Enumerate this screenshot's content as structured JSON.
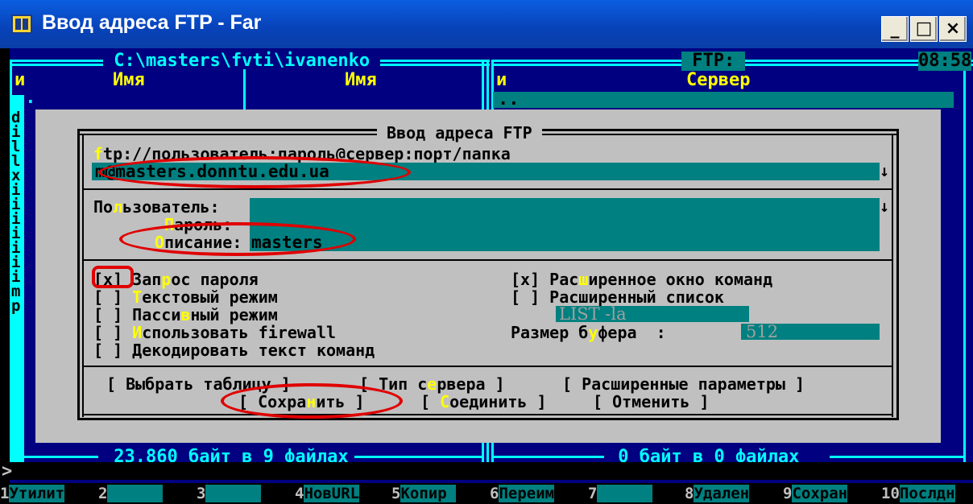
{
  "window": {
    "title": "Ввод адреса FTP - Far",
    "min_label": "_",
    "max_label": "□",
    "close_label": "×"
  },
  "left_panel": {
    "path": " C:\\masters\\fvti\\ivanenko ",
    "col_n": "и",
    "col_name1": "Имя",
    "col_name2": "Имя",
    "updir": "..",
    "file_letters": [
      "d",
      "i",
      "l",
      "l",
      "x",
      "i",
      "i",
      "i",
      "i",
      "i",
      "i",
      "i",
      "m",
      "p"
    ],
    "footer": " 23,860 байт в 9 файлах "
  },
  "right_panel": {
    "title": " FTP: ",
    "clock": "08:58",
    "col_n": "и",
    "col_server": "Сервер",
    "updir": "..",
    "footer": " 0 байт в 0 файлах "
  },
  "dialog": {
    "title": " Ввод адреса FTP ",
    "url_hint": {
      "hot": "f",
      "rest": "tp://пользователь:пароль@сервер:порт/папка"
    },
    "url_value": "m@masters.donntu.edu.ua",
    "user_label": {
      "pre": "По",
      "hot": "л",
      "post": "ьзователь:"
    },
    "user_value": "",
    "password_label": {
      "hot": "П",
      "post": "ароль:"
    },
    "description_label": {
      "hot": "О",
      "post": "писание:"
    },
    "description_value": "masters",
    "options_left": [
      {
        "box": "[x]",
        "pre": " Зап",
        "hot": "р",
        "post": "ос пароля"
      },
      {
        "box": "[ ]",
        "pre": " ",
        "hot": "Т",
        "post": "екстовый режим"
      },
      {
        "box": "[ ]",
        "pre": " Пасси",
        "hot": "в",
        "post": "ный режим"
      },
      {
        "box": "[ ]",
        "pre": " ",
        "hot": "И",
        "post": "спользовать firewall"
      },
      {
        "box": "[ ]",
        "pre": " Декодировать текст команд",
        "hot": "",
        "post": ""
      }
    ],
    "options_right": [
      {
        "box": "[x]",
        "pre": " Рас",
        "hot": "ш",
        "post": "иренное окно команд"
      },
      {
        "box": "[ ]",
        "pre": " Расширенный список",
        "hot": "",
        "post": ""
      }
    ],
    "list_cmd": "LIST -la",
    "buffer_label": {
      "pre": "Размер б",
      "hot": "у",
      "post": "фера  :"
    },
    "buffer_value": "512",
    "buttons_row1": {
      "select_table": "[ Выбрать таблицу ]",
      "server_type": {
        "pre": "[ Тип с",
        "hot": "е",
        "post": "рвера ]"
      },
      "extended": "[ Расширенные параметры ]"
    },
    "buttons_row2": {
      "save": {
        "pre": "[ Сохра",
        "hot": "н",
        "post": "ить ]"
      },
      "connect": {
        "pre": "[ ",
        "hot": "С",
        "post": "оединить ]"
      },
      "cancel": "[ Отменить ]"
    }
  },
  "cmdline": {
    "prompt": ">"
  },
  "keybar": [
    {
      "n": "1",
      "label": "Утилит"
    },
    {
      "n": "2",
      "label": "      "
    },
    {
      "n": "3",
      "label": "      "
    },
    {
      "n": "4",
      "label": "НовURL"
    },
    {
      "n": "5",
      "label": "Копир "
    },
    {
      "n": "6",
      "label": "Переим"
    },
    {
      "n": "7",
      "label": "      "
    },
    {
      "n": "8",
      "label": "Удален"
    },
    {
      "n": "9",
      "label": "Сохран"
    },
    {
      "n": "10",
      "label": "Послдн"
    }
  ],
  "colors": {
    "panel_bg": "#000080",
    "frame": "#00ffff",
    "dialog_bg": "#c0c0c0",
    "field_bg": "#008080",
    "hotkey": "#ffff00",
    "annotation": "#e00000"
  }
}
